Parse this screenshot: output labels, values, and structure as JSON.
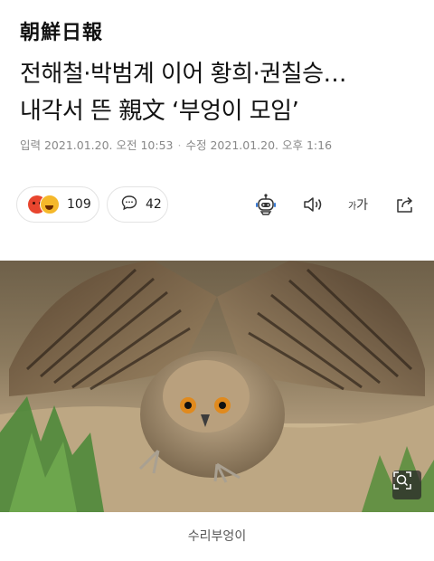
{
  "masthead": "朝鮮日報",
  "article": {
    "headline_line1": "전해철·박범계 이어 황희·권칠승…",
    "headline_line2": "내각서 뜬 親文 ‘부엉이 모임’",
    "published": "입력 2021.01.20. 오전 10:53",
    "updated": "수정 2021.01.20. 오후 1:16",
    "separator": "·"
  },
  "reactions": {
    "count": "109",
    "icons": [
      "angry-emoji",
      "laugh-emoji"
    ]
  },
  "comments": {
    "count": "42",
    "icon": "comment-icon"
  },
  "toolbar": {
    "icons": [
      "robot-icon",
      "speaker-icon",
      "font-size-icon",
      "share-icon"
    ],
    "font_small": "가",
    "font_large": "가"
  },
  "photo": {
    "caption": "수리부엉이",
    "zoom_icon": "zoom-icon"
  }
}
